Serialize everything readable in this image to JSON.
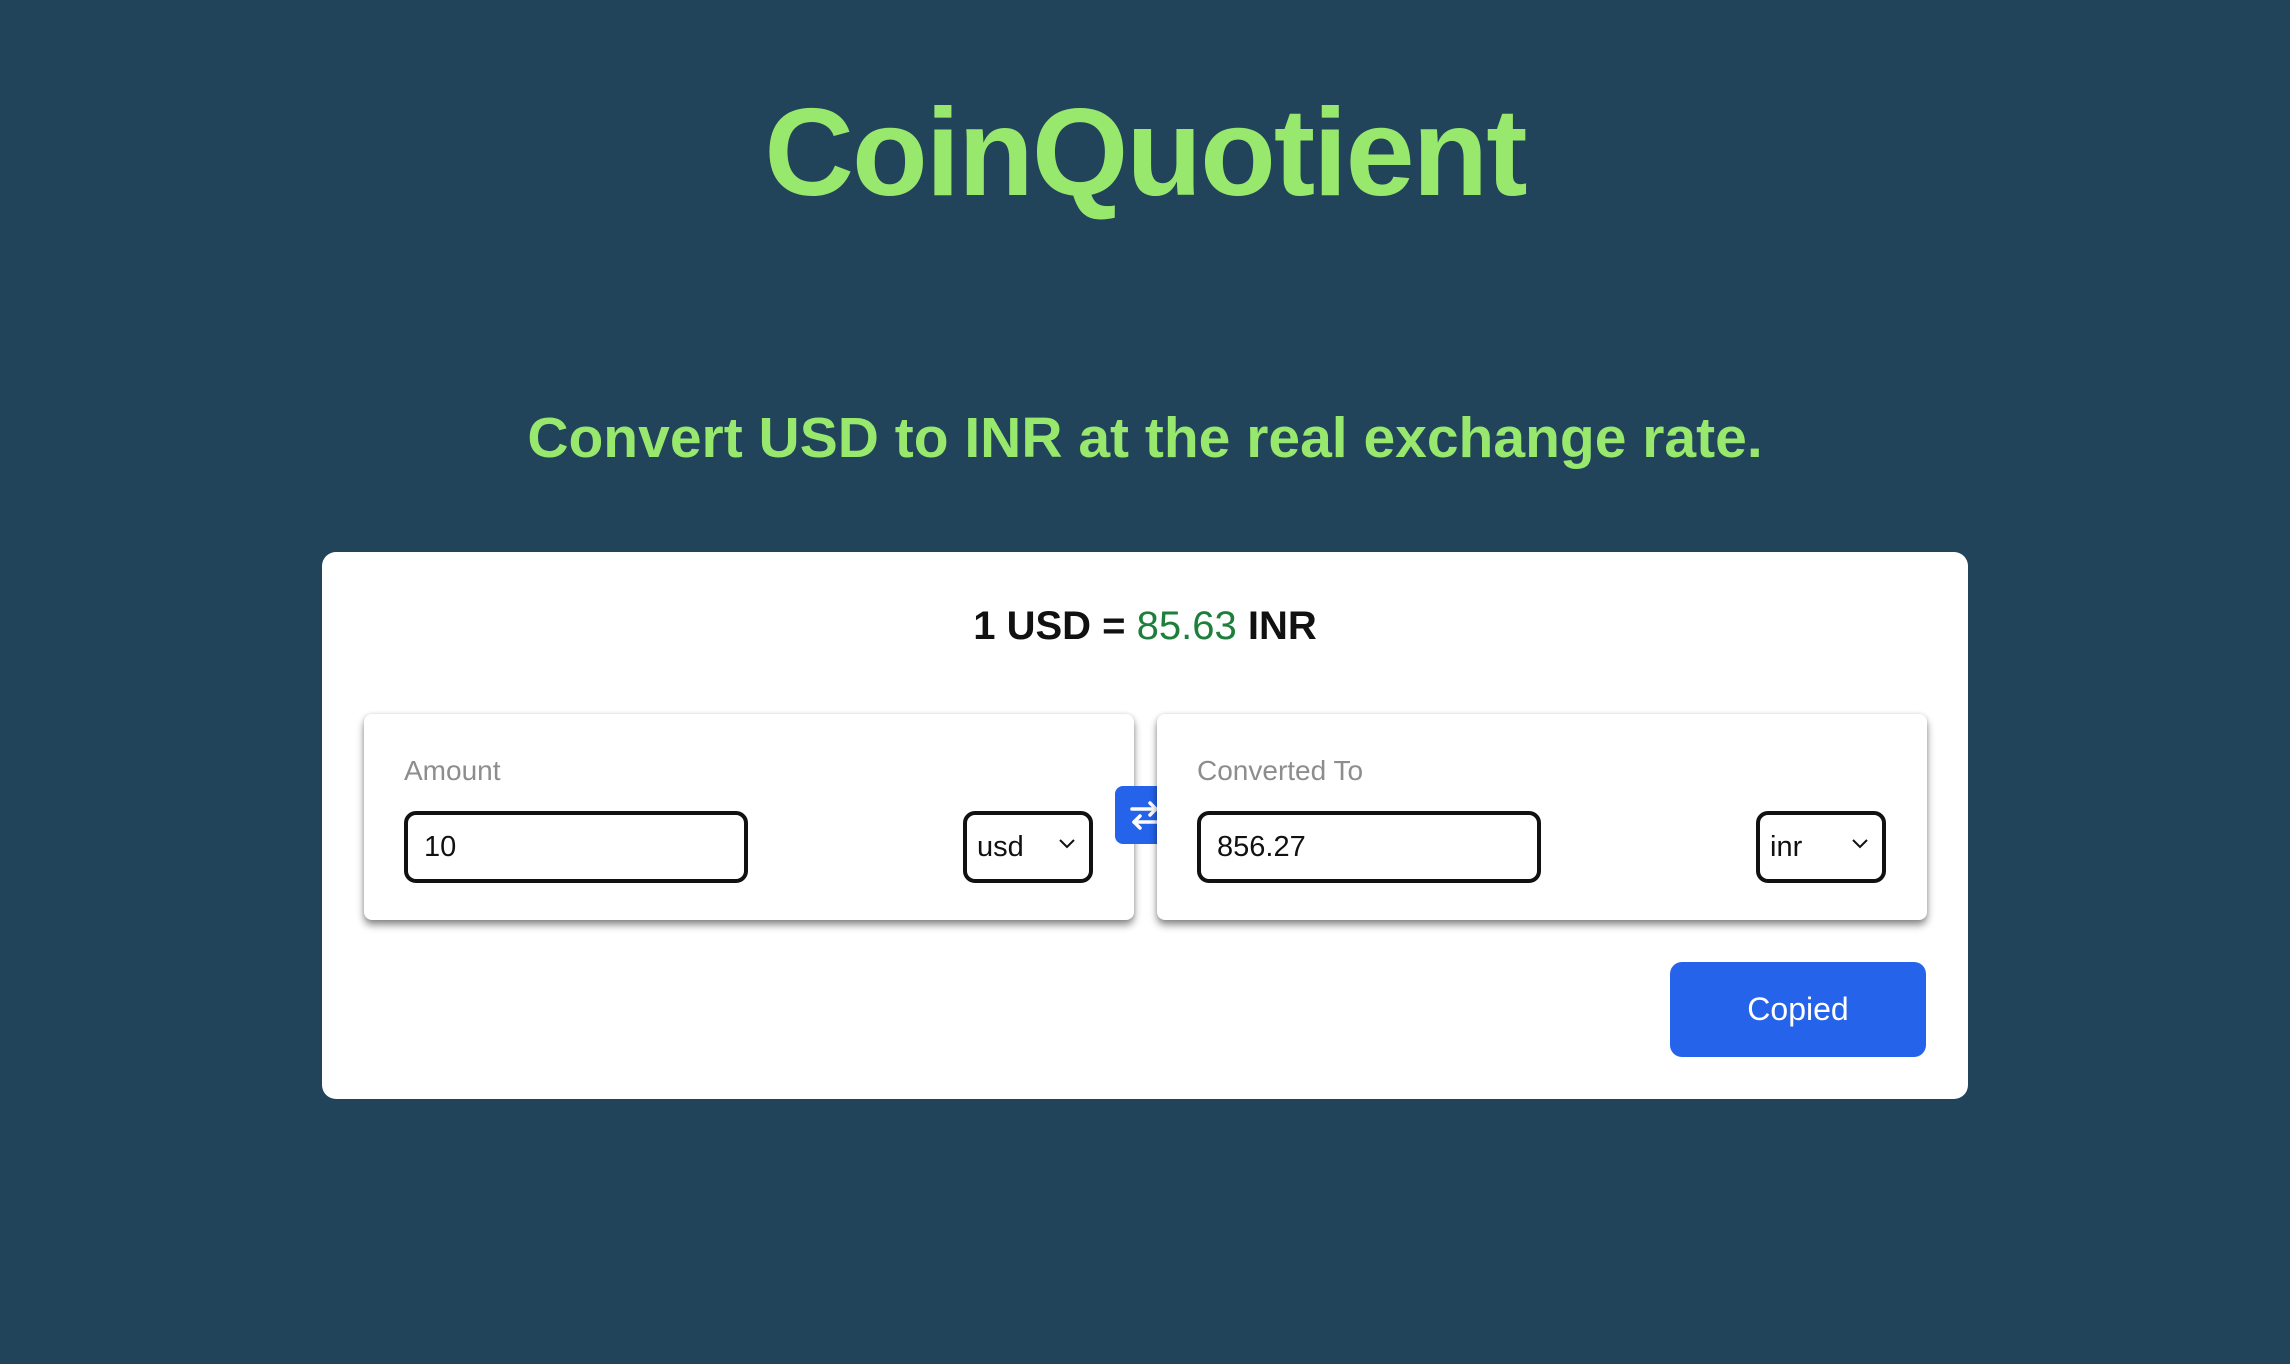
{
  "app": {
    "title": "CoinQuotient",
    "tagline": "Convert USD to INR at the real exchange rate."
  },
  "rate": {
    "prefix": "1 USD = ",
    "value": "85.63",
    "suffix": " INR"
  },
  "from": {
    "label": "Amount",
    "value": "10",
    "currency": "usd"
  },
  "to": {
    "label": "Converted To",
    "value": "856.27",
    "currency": "inr"
  },
  "actions": {
    "copy_label": "Copied"
  },
  "icons": {
    "swap": "swap-arrows-icon",
    "dropdown": "chevron-down-icon"
  },
  "colors": {
    "background": "#22445a",
    "accent_green": "#97e86d",
    "rate_green": "#1d7f3b",
    "primary_blue": "#2563eb"
  }
}
